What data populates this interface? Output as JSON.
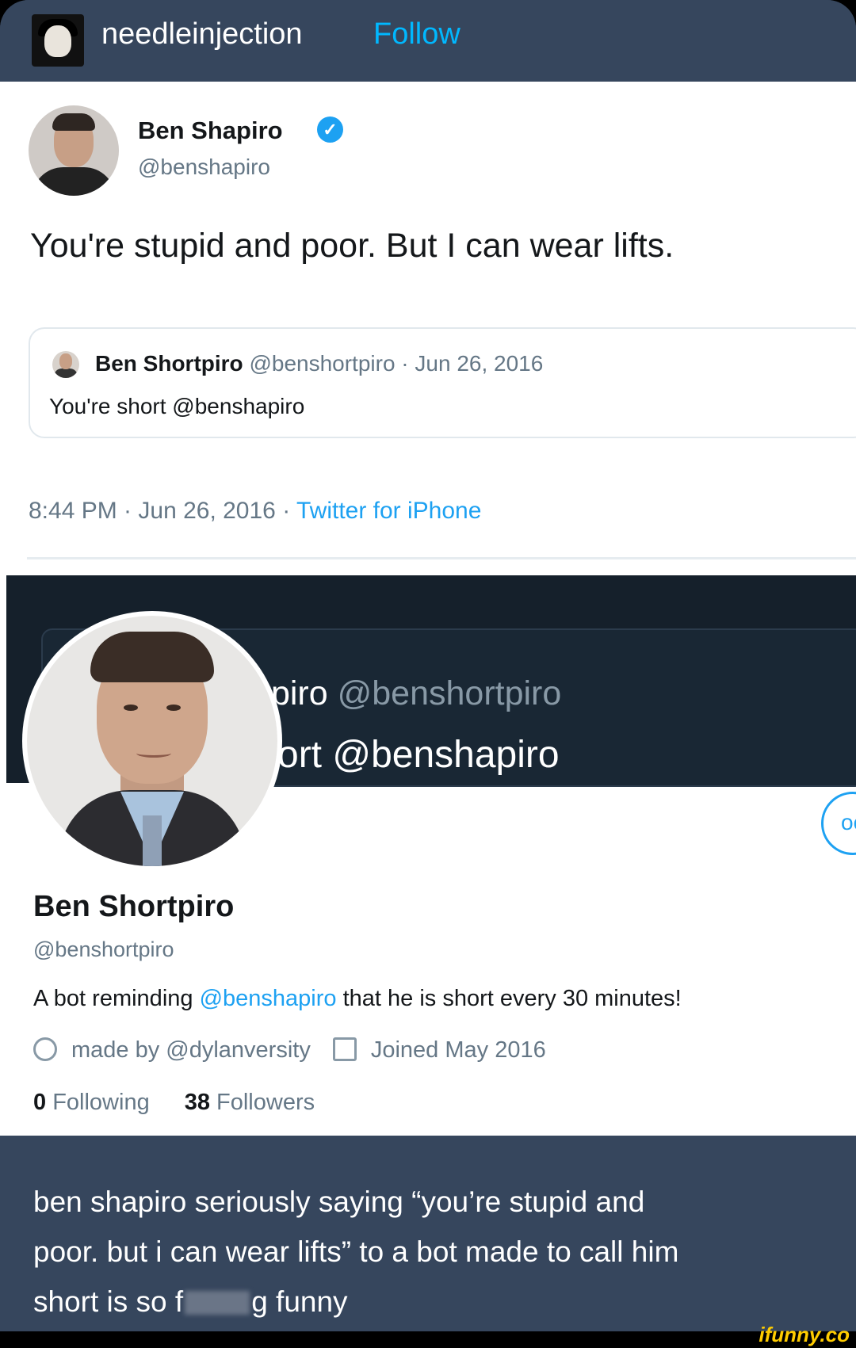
{
  "post": {
    "username": "needleinjection",
    "follow_label": "Follow"
  },
  "tweet": {
    "name": "Ben Shapiro",
    "verified_glyph": "✓",
    "handle": "@benshapiro",
    "text": "You're stupid and poor. But I can wear lifts.",
    "quote": {
      "name": "Ben Shortpiro",
      "meta": " @benshortpiro · Jun 26, 2016",
      "text": "You're short @benshapiro"
    },
    "time": "8:44 PM · Jun 26, 2016 · ",
    "source": "Twitter for iPhone"
  },
  "profile": {
    "banner_fragment_1_name": "tpiro",
    "banner_fragment_1_handle": " @benshortpiro",
    "banner_fragment_2": "ort @benshapiro",
    "more_glyph": "oo",
    "name": "Ben Shortpiro",
    "handle": "@benshortpiro",
    "bio_prefix": "A bot reminding ",
    "bio_mention": "@benshapiro",
    "bio_suffix": " that he is short every 30 minutes!",
    "location": "made by @dylanversity",
    "joined": "Joined May 2016",
    "following_count": "0",
    "following_label": " Following",
    "followers_count": "38",
    "followers_label": " Followers"
  },
  "caption": {
    "line1": "ben shapiro seriously saying “you’re stupid and",
    "line2": "poor. but i can wear lifts” to a bot made to call him",
    "line3_start": "short is so f",
    "line3_end": "g funny"
  },
  "watermark": "ifunny.co",
  "colors": {
    "tumblr_bg": "#36465d",
    "follow": "#00b8ff",
    "twitter_blue": "#1da1f2"
  }
}
